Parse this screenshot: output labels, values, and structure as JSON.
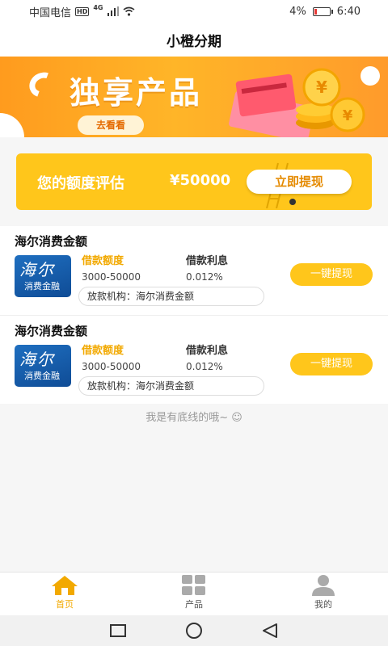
{
  "status_bar": {
    "carrier": "中国电信",
    "hd": "HD",
    "network": "4G",
    "battery": "4%",
    "time": "6:40"
  },
  "app": {
    "title": "小橙分期"
  },
  "banner": {
    "title": "独享产品",
    "button": "去看看"
  },
  "quota": {
    "label": "您的额度评估",
    "amount": "¥50000",
    "button": "立即提现"
  },
  "products": [
    {
      "name": "海尔消费金额",
      "logo_main": "海尔",
      "logo_sub": "消费金融",
      "amount_label": "借款额度",
      "amount_value": "3000-50000",
      "rate_label": "借款利息",
      "rate_value": "0.012%",
      "lender": "放款机构：海尔消费金额",
      "button": "一键提现"
    },
    {
      "name": "海尔消费金额",
      "logo_main": "海尔",
      "logo_sub": "消费金融",
      "amount_label": "借款额度",
      "amount_value": "3000-50000",
      "rate_label": "借款利息",
      "rate_value": "0.012%",
      "lender": "放款机构：海尔消费金额",
      "button": "一键提现"
    }
  ],
  "footer_note": "我是有底线的哦~ ☺",
  "tabs": [
    {
      "label": "首页",
      "icon": "home-icon",
      "active": true
    },
    {
      "label": "产品",
      "icon": "grid-icon",
      "active": false
    },
    {
      "label": "我的",
      "icon": "user-icon",
      "active": false
    }
  ],
  "colors": {
    "accent": "#ffc61b",
    "banner_orange": "#ff9b1e",
    "label_gold": "#f2a900"
  }
}
